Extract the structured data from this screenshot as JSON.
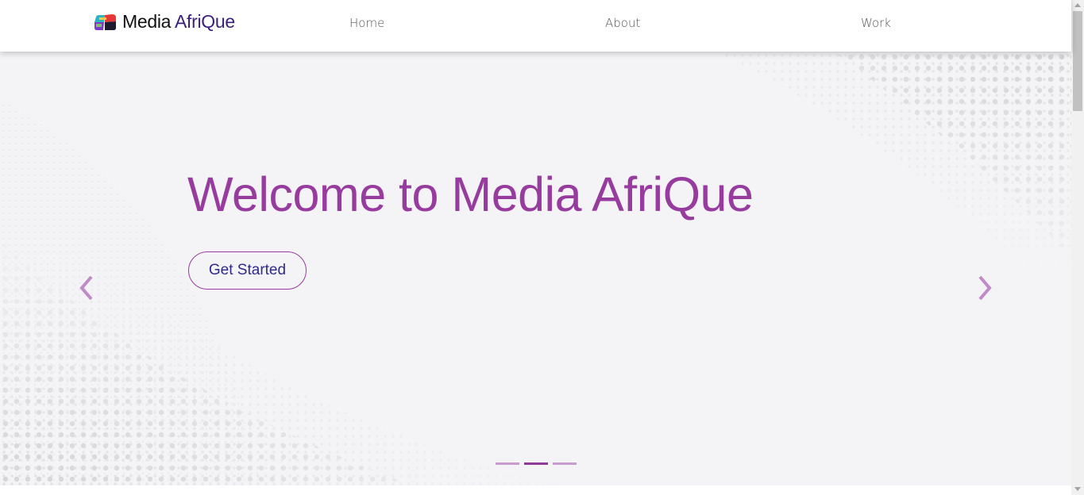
{
  "navbar": {
    "brand_prefix": "Media",
    "brand_accent": "AfriQue",
    "logo_icon": "media-afrique-logo",
    "links": [
      "Home",
      "About",
      "Work"
    ]
  },
  "hero": {
    "title": "Welcome to Media AfriQue",
    "cta_label": "Get Started",
    "prev_icon": "chevron-left",
    "next_icon": "chevron-right",
    "slide_count": 3,
    "active_slide": 2
  },
  "colors": {
    "title": "#973c9e",
    "cta_text": "#2f2a8c",
    "cta_border": "#973c9e",
    "arrow": "#c08ac8",
    "indicator": "#c99bd0",
    "indicator_active": "#8e3c98",
    "brand_accent": "#3b1f7a",
    "hero_background": "#f4f3f6"
  }
}
